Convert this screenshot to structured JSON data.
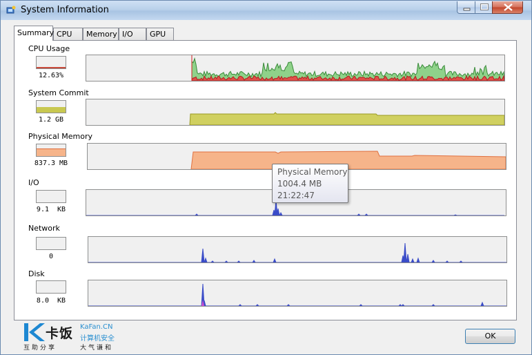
{
  "window": {
    "title": "System Information"
  },
  "colors": {
    "cpu_green": "#8fd28a",
    "cpu_red": "#e0504a",
    "commit": "#d0d060",
    "physmem": "#f6b48a",
    "io": "#3a4cc8",
    "disk_pink": "#d050d0"
  },
  "tabs": [
    {
      "label": "Summary",
      "active": true
    },
    {
      "label": "CPU",
      "active": false
    },
    {
      "label": "Memory",
      "active": false
    },
    {
      "label": "I/O",
      "active": false
    },
    {
      "label": "GPU",
      "active": false
    }
  ],
  "sections": {
    "cpu": {
      "label": "CPU Usage",
      "value": "12.63%",
      "level": 0.13
    },
    "commit": {
      "label": "System Commit",
      "value": "1.2 GB",
      "level": 0.45
    },
    "physmem": {
      "label": "Physical Memory",
      "value": "837.3 MB",
      "level": 0.6
    },
    "io": {
      "label": "I/O",
      "value": "9.1  KB",
      "level": 0
    },
    "network": {
      "label": "Network",
      "value": "0",
      "level": 0
    },
    "disk": {
      "label": "Disk",
      "value": "8.0  KB",
      "level": 0
    }
  },
  "tooltip": {
    "title": "Physical Memory",
    "value": "1004.4 MB",
    "time": "21:22:47"
  },
  "buttons": {
    "ok": "OK"
  },
  "logo": {
    "cn": "卡饭",
    "en": "KaFan.CN",
    "cn2": "计算机安全",
    "sub1": "互助分享",
    "sub2": "大气谦和"
  }
}
